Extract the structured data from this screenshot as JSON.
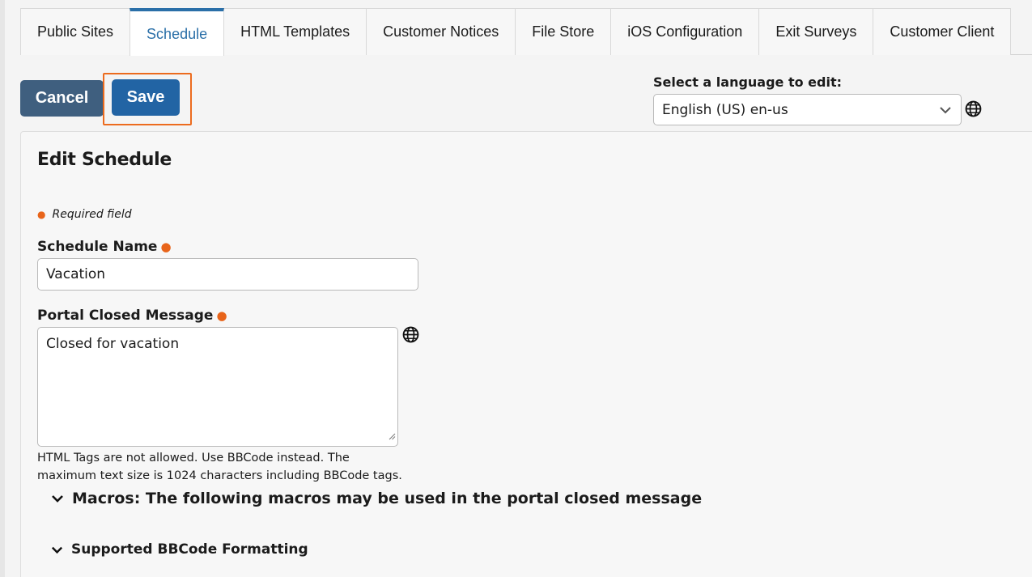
{
  "tabs": [
    {
      "label": "Public Sites",
      "active": false
    },
    {
      "label": "Schedule",
      "active": true
    },
    {
      "label": "HTML Templates",
      "active": false
    },
    {
      "label": "Customer Notices",
      "active": false
    },
    {
      "label": "File Store",
      "active": false
    },
    {
      "label": "iOS Configuration",
      "active": false
    },
    {
      "label": "Exit Surveys",
      "active": false
    },
    {
      "label": "Customer Client",
      "active": false
    }
  ],
  "actions": {
    "cancel_label": "Cancel",
    "save_label": "Save"
  },
  "language": {
    "label": "Select a language to edit:",
    "selected": "English (US) en-us",
    "icon": "globe-icon"
  },
  "form": {
    "title": "Edit Schedule",
    "required_note": "Required field",
    "schedule_name": {
      "label": "Schedule Name",
      "value": "Vacation"
    },
    "closed_message": {
      "label": "Portal Closed Message",
      "value": "Closed for vacation",
      "help": "HTML Tags are not allowed. Use BBCode instead. The maximum text size is 1024 characters including BBCode tags."
    },
    "sections": {
      "macros": "Macros: The following macros may be used in the portal closed message",
      "bbcode": "Supported BBCode Formatting"
    }
  },
  "colors": {
    "accent": "#2a6fa8",
    "save_button": "#2264a4",
    "cancel_button": "#3f5f7f",
    "required": "#e8641a",
    "highlight": "#ec6b1e"
  }
}
